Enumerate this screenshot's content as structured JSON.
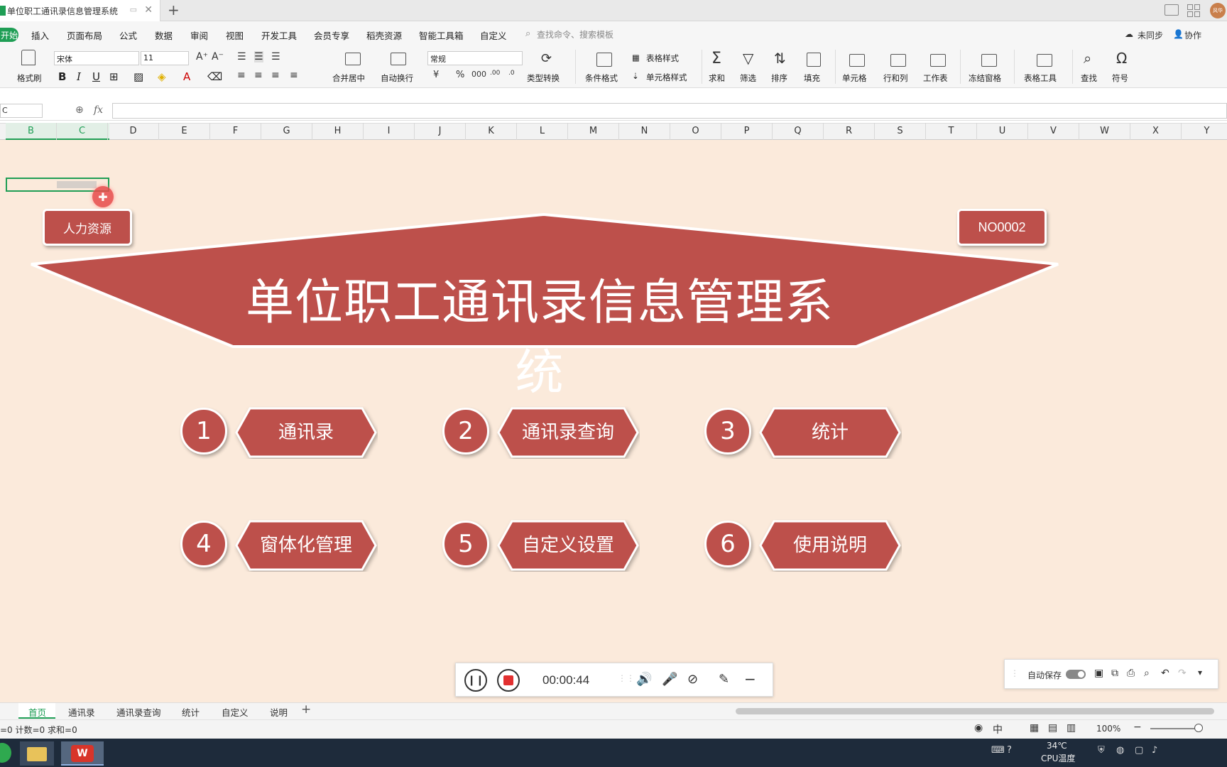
{
  "window": {
    "doc_title": "单位职工通讯录信息管理系统"
  },
  "menu": {
    "start": "开始",
    "items": [
      "插入",
      "页面布局",
      "公式",
      "数据",
      "审阅",
      "视图",
      "开发工具",
      "会员专享",
      "稻壳资源",
      "智能工具箱",
      "自定义"
    ],
    "search": "查找命令、搜索模板",
    "not_synced": "未同步",
    "collab": "协作"
  },
  "ribbon": {
    "format_painter": "格式刷",
    "font_name": "宋体",
    "font_size": "11",
    "merge_center": "合并居中",
    "wrap_text": "自动换行",
    "number_format": "常规",
    "type_convert": "类型转换",
    "conditional_format": "条件格式",
    "table_style": "表格样式",
    "cell_style": "单元格样式",
    "sum": "求和",
    "filter": "筛选",
    "sort": "排序",
    "fill": "填充",
    "cell": "单元格",
    "row_col": "行和列",
    "worksheet": "工作表",
    "freeze": "冻结窗格",
    "table_tools": "表格工具",
    "find": "查找",
    "symbol": "符号"
  },
  "formula_bar": {
    "namebox": "C",
    "fx": "fx",
    "value": ""
  },
  "columns": [
    "B",
    "C",
    "D",
    "E",
    "F",
    "G",
    "H",
    "I",
    "J",
    "K",
    "L",
    "M",
    "N",
    "O",
    "P",
    "Q",
    "R",
    "S",
    "T",
    "U",
    "V",
    "W",
    "X",
    "Y"
  ],
  "dashboard": {
    "hr_button": "人力资源",
    "record_no": "NO0002",
    "title": "单位职工通讯录信息管理系统",
    "modules": [
      {
        "num": "1",
        "label": "通讯录"
      },
      {
        "num": "2",
        "label": "通讯录查询"
      },
      {
        "num": "3",
        "label": "统计"
      },
      {
        "num": "4",
        "label": "窗体化管理"
      },
      {
        "num": "5",
        "label": "自定义设置"
      },
      {
        "num": "6",
        "label": "使用说明"
      }
    ],
    "colors": {
      "accent": "#bd504b",
      "background": "#fbeadb"
    }
  },
  "recorder": {
    "time": "00:00:44"
  },
  "autosave": {
    "label": "自动保存"
  },
  "sheet_tabs": [
    "首页",
    "通讯录",
    "通讯录查询",
    "统计",
    "自定义",
    "说明"
  ],
  "active_tab": "首页",
  "status": {
    "summary": "=0  计数=0  求和=0",
    "zoom": "100%"
  },
  "taskbar": {
    "temperature": "34℃",
    "cpu_label": "CPU温度"
  }
}
